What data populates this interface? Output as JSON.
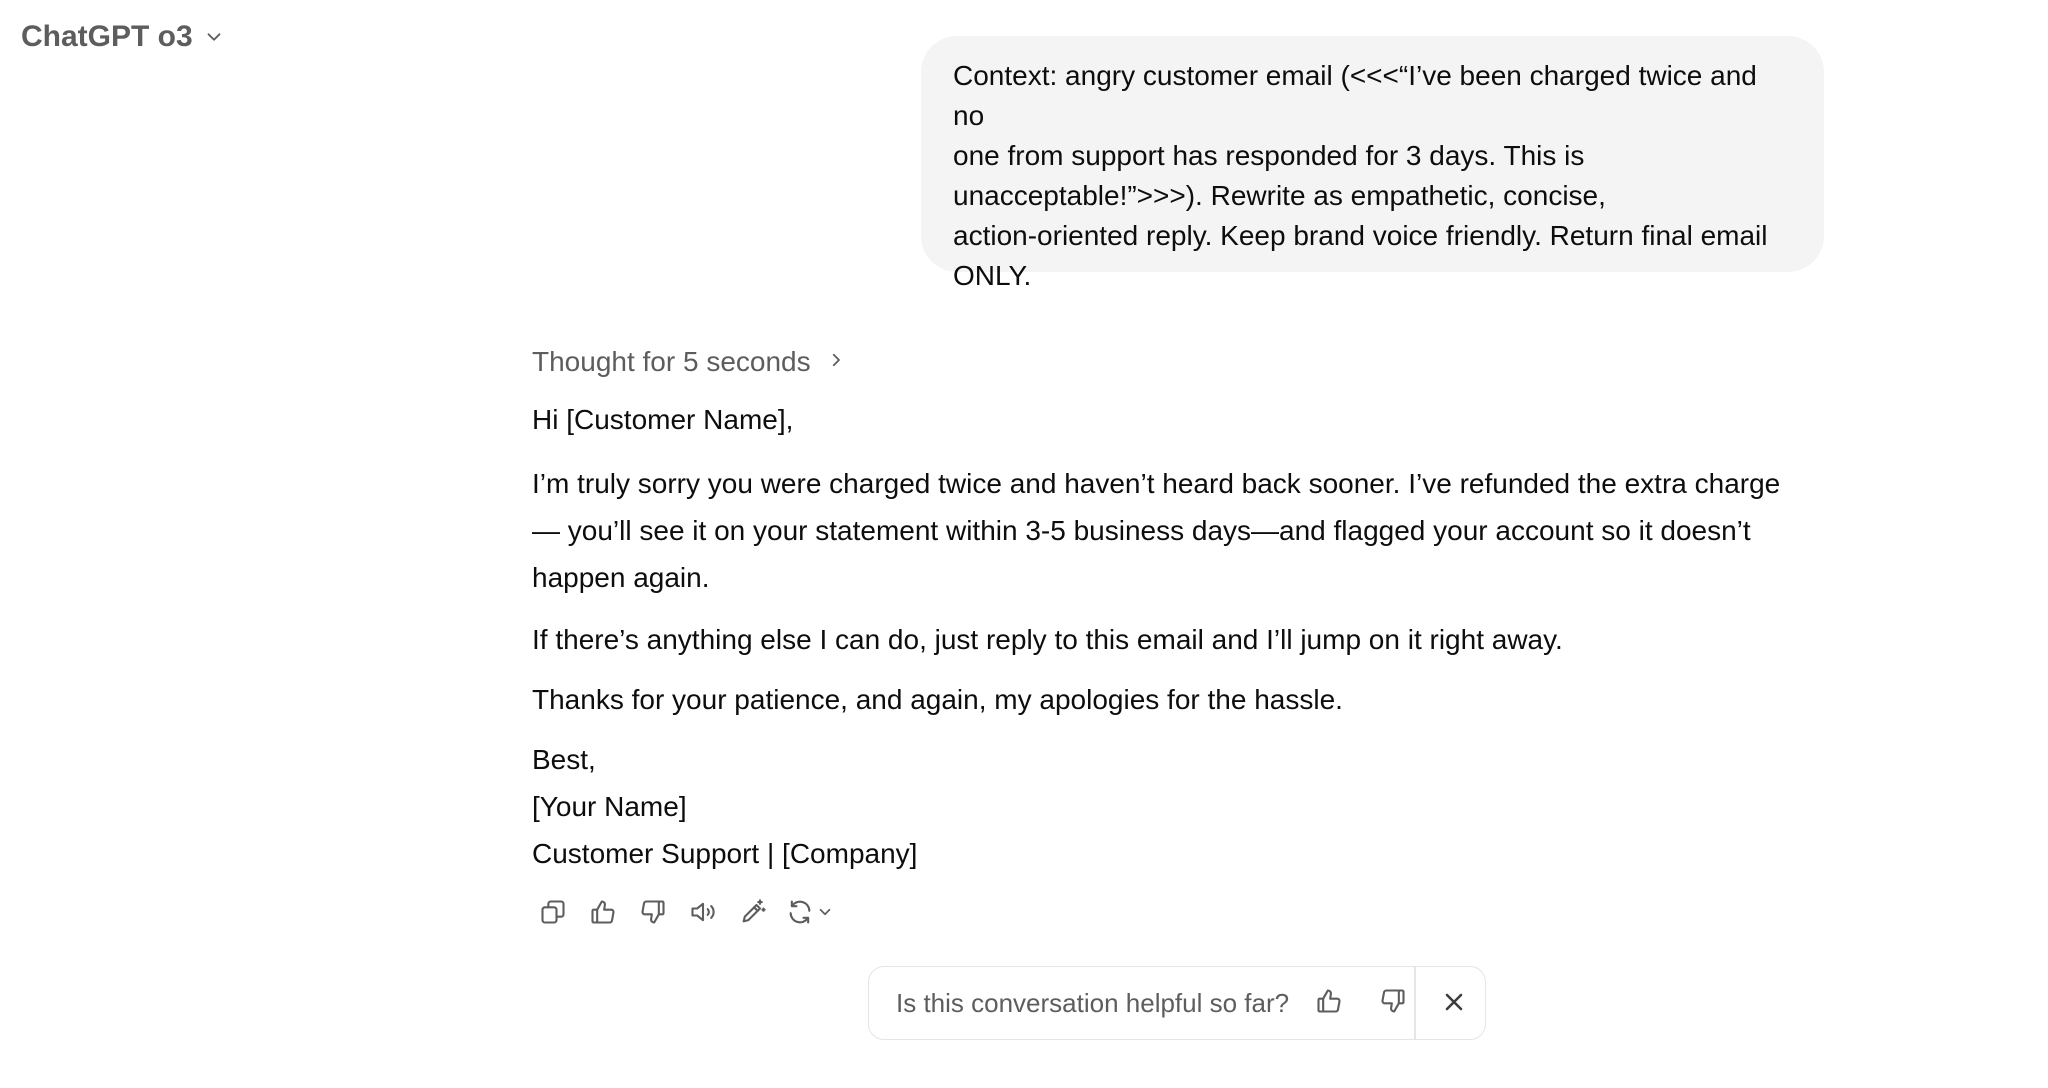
{
  "header": {
    "model_name": "ChatGPT o3",
    "chevron_icon": "chevron-down-icon"
  },
  "user_message": {
    "text_lines": [
      "Context: angry customer email (<<<“I’ve been charged twice and no",
      "one from support has responded for 3 days. This is",
      "unacceptable!”>>>). Rewrite as empathetic, concise,",
      "action-oriented reply. Keep brand voice friendly. Return final email",
      "ONLY."
    ]
  },
  "assistant": {
    "thought_label": "Thought for 5 seconds",
    "greeting": "Hi [Customer Name],",
    "paragraph1_lines": [
      "I’m truly sorry you were charged twice and haven’t heard back sooner. I’ve refunded the extra charge",
      "— you’ll see it on your statement within 3-5 business days—and flagged your account so it doesn’t",
      "happen again."
    ],
    "paragraph2": "If there’s anything else I can do, just reply to this email and I’ll jump on it right away.",
    "paragraph3": "Thanks for your patience, and again, my apologies for the hassle.",
    "signoff": "Best,",
    "sig_name": "[Your Name]",
    "sig_title": "Customer Support | [Company]"
  },
  "actions": {
    "icons": [
      "copy-icon",
      "thumbs-up-icon",
      "thumbs-down-icon",
      "read-aloud-icon",
      "edit-in-canvas-icon",
      "regenerate-icon"
    ]
  },
  "feedback": {
    "question": "Is this conversation helpful so far?",
    "icons": [
      "thumbs-up-icon",
      "thumbs-down-icon",
      "close-icon"
    ]
  },
  "colors": {
    "bubble_bg": "#f4f4f4",
    "muted_text": "#5d5d5d",
    "body_text": "#0d0d0d",
    "border": "#e5e5e5"
  }
}
